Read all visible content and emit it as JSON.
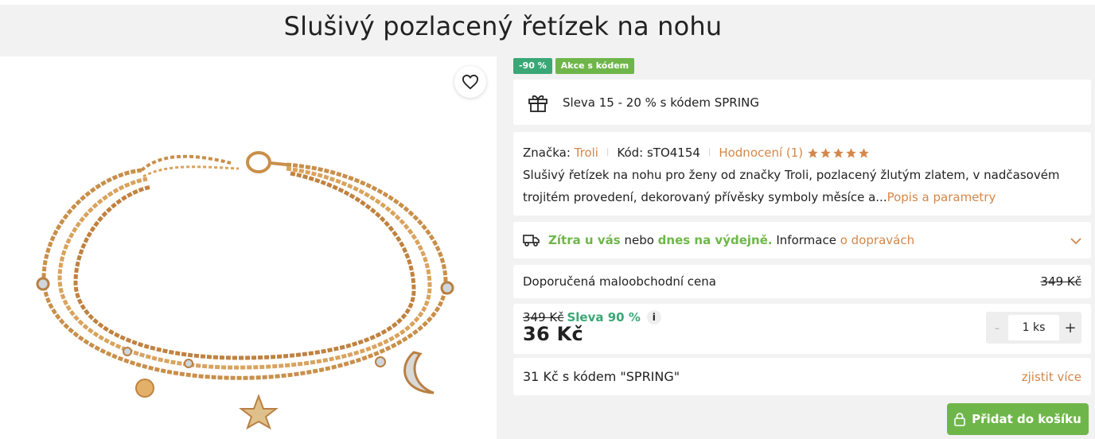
{
  "product": {
    "title": "Slušivý pozlacený řetízek na nohu"
  },
  "badges": {
    "discount": "-90 %",
    "promo": "Akce s kódem"
  },
  "promo": {
    "text": "Sleva 15 - 20 % s kódem SPRING",
    "icon": "gift-icon"
  },
  "info": {
    "brand_label": "Značka:",
    "brand": "Troli",
    "code_label": "Kód:",
    "code": "sTO4154",
    "rating_label": "Hodnocení (1)",
    "rating_stars": 5,
    "description": "Slušivý řetízek na nohu pro ženy od značky Troli, pozlacený žlutým zlatem, v nadčasovém trojitém provedení, dekorovaný přívěsky symboly měsíce a...",
    "description_link": "Popis a parametry"
  },
  "shipping": {
    "tomorrow": "Zítra u vás",
    "or": "nebo",
    "today_pickup": "dnes na výdejně.",
    "info_label": "Informace",
    "info_link": "o dopravách"
  },
  "rrp": {
    "label": "Doporučená maloobchodní cena",
    "value": "349 Kč"
  },
  "price": {
    "old": "349 Kč",
    "discount": "Sleva 90 %",
    "info_icon": "i",
    "current": "36 Kč"
  },
  "quantity": {
    "minus": "-",
    "value": "1 ks",
    "plus": "+"
  },
  "code_offer": {
    "text": "31 Kč s kódem \"SPRING\"",
    "link": "zjistit více"
  },
  "cart": {
    "label": "Přidat do košíku"
  },
  "colors": {
    "accent": "#d4874a",
    "green": "#6fb64a",
    "green_dark": "#3aa876"
  }
}
